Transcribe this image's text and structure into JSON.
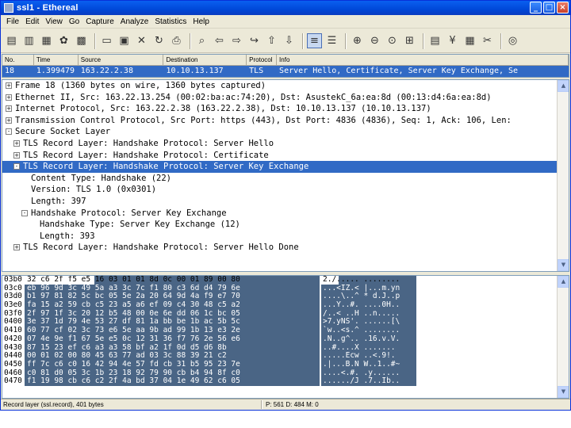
{
  "window": {
    "title": "ssl1 - Ethereal",
    "buttons": {
      "minimize": "_",
      "maximize": "□",
      "close": "×"
    }
  },
  "menu": {
    "items": [
      "File",
      "Edit",
      "View",
      "Go",
      "Capture",
      "Analyze",
      "Statistics",
      "Help"
    ]
  },
  "toolbar": {
    "icons": [
      "interface-list-icon",
      "capture-options-icon",
      "start-capture-icon",
      "restart-capture-icon",
      "stop-capture-icon",
      "open-file-icon",
      "save-file-icon",
      "close-file-icon",
      "reload-icon",
      "print-icon",
      "find-packet-icon",
      "go-back-icon",
      "go-forward-icon",
      "go-to-packet-icon",
      "go-first-icon",
      "go-last-icon",
      "colorize-icon",
      "auto-scroll-icon",
      "zoom-in-icon",
      "zoom-out-icon",
      "normal-size-icon",
      "resize-columns-icon",
      "capture-filters-icon",
      "display-filters-icon",
      "coloring-rules-icon",
      "preferences-icon",
      "help-icon"
    ]
  },
  "packet_list": {
    "columns": [
      "No.",
      "Time",
      "Source",
      "Destination",
      "Protocol",
      "Info"
    ],
    "selected_row": {
      "no": "18",
      "time": "1.399479",
      "source": "163.22.2.38",
      "destination": "10.10.13.137",
      "protocol": "TLS",
      "info": "Server Hello, Certificate, Server Key Exchange, Se"
    }
  },
  "details": {
    "lines": [
      {
        "text": "Frame 18 (1360 bytes on wire, 1360 bytes captured)",
        "expander": "+",
        "indent": 0
      },
      {
        "text": "Ethernet II, Src: 163.22.13.254 (00:02:ba:ac:74:20), Dst: AsustekC_6a:ea:8d (00:13:d4:6a:ea:8d)",
        "expander": "+",
        "indent": 0
      },
      {
        "text": "Internet Protocol, Src: 163.22.2.38 (163.22.2.38), Dst: 10.10.13.137 (10.10.13.137)",
        "expander": "+",
        "indent": 0
      },
      {
        "text": "Transmission Control Protocol, Src Port: https (443), Dst Port: 4836 (4836), Seq: 1, Ack: 106, Len:",
        "expander": "+",
        "indent": 0
      },
      {
        "text": "Secure Socket Layer",
        "expander": "-",
        "indent": 0
      },
      {
        "text": "TLS Record Layer: Handshake Protocol: Server Hello",
        "expander": "+",
        "indent": 1
      },
      {
        "text": "TLS Record Layer: Handshake Protocol: Certificate",
        "expander": "+",
        "indent": 1
      },
      {
        "text": "TLS Record Layer: Handshake Protocol: Server Key Exchange",
        "expander": "-",
        "indent": 1,
        "selected": true
      },
      {
        "text": "Content Type: Handshake (22)",
        "expander": "",
        "indent": 2
      },
      {
        "text": "Version: TLS 1.0 (0x0301)",
        "expander": "",
        "indent": 2
      },
      {
        "text": "Length: 397",
        "expander": "",
        "indent": 2
      },
      {
        "text": "Handshake Protocol: Server Key Exchange",
        "expander": "-",
        "indent": "2e"
      },
      {
        "text": "Handshake Type: Server Key Exchange (12)",
        "expander": "",
        "indent": 3
      },
      {
        "text": "Length: 393",
        "expander": "",
        "indent": 3
      },
      {
        "text": "TLS Record Layer: Handshake Protocol: Server Hello Done",
        "expander": "+",
        "indent": 1
      }
    ]
  },
  "hex": {
    "rows": [
      {
        "offset": "03b0",
        "bytes": "32 c6 2f f5 e5 16 03 01  01 8d 0c 00 01 89 00 80",
        "ascii": "2./.....  ........"
      },
      {
        "offset": "03c0",
        "bytes": "eb 96 9d 3c 49 5a a3 3c  7c f1 80 c3 6d d4 79 6e",
        "ascii": "...<IZ.<  |...m.yn"
      },
      {
        "offset": "03d0",
        "bytes": "b1 97 81 82 5c bc 05 5e  2a 20 64 9d 4a f9 e7 70",
        "ascii": "....\\..^  * d.J..p"
      },
      {
        "offset": "03e0",
        "bytes": "fa 15 a2 59 cb c5 23 a5  a6 ef 09 c4 30 48 c5 a2",
        "ascii": "...Y..#.  ....0H.."
      },
      {
        "offset": "03f0",
        "bytes": "2f 97 1f 3c 20 12 b5 48  00 0e 6e dd 06 1c bc 05",
        "ascii": "/..< ..H  ..n....."
      },
      {
        "offset": "0400",
        "bytes": "3e 37 1d 79 4e 53 27 df  81 1a bb be 1b ac 5b 5c",
        "ascii": ">7.yNS'.  ......[\\"
      },
      {
        "offset": "0410",
        "bytes": "60 77 cf 02 3c 73 e6 5e  aa 9b ad 99 1b 13 e3 2e",
        "ascii": "`w..<s.^  ........"
      },
      {
        "offset": "0420",
        "bytes": "07 4e 9e f1 67 5e e5 0c  12 31 36 f7 76 2e 56 e6",
        "ascii": ".N..g^..  .16.v.V."
      },
      {
        "offset": "0430",
        "bytes": "87 15 23 ef c6 a3 a3 58  bf a2 1f 0d d5 d6 8b",
        "ascii": "..#....X  ......."
      },
      {
        "offset": "0440",
        "bytes": "00 01 02 00 80 45 63 77  ad 03 3c 88 39 21 c2",
        "ascii": ".....Ecw  ..<.9!."
      },
      {
        "offset": "0450",
        "bytes": "ff 7c c6 c0 16 42 94 4e  57 fd cb 31 b5 95 23 7e",
        "ascii": ".|...B.N  W..1..#~"
      },
      {
        "offset": "0460",
        "bytes": "c0 81 d0 05 3c 1b 23 18  92 79 90 cb b4 94 8f c0",
        "ascii": "....<.#.  .y......"
      },
      {
        "offset": "0470",
        "bytes": "f1 19 98 cb c6 c2 2f 4a  bd 37 04 1e 49 62 c6 05",
        "ascii": "....../J  .7..Ib.."
      }
    ]
  },
  "status": {
    "left": "Record layer (ssl.record), 401 bytes",
    "right": "P: 561 D: 484 M: 0"
  }
}
